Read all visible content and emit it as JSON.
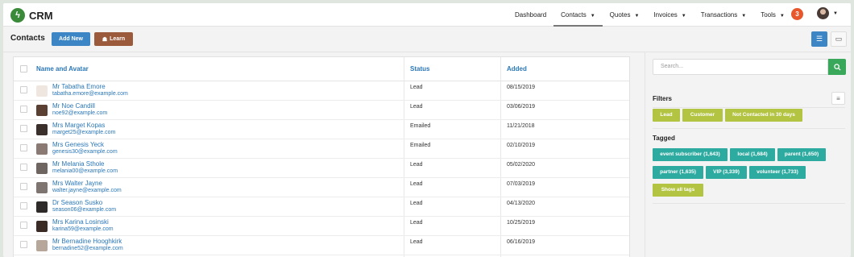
{
  "app": {
    "name": "CRM",
    "logo_glyph": "ϟ"
  },
  "nav": {
    "items": [
      {
        "label": "Dashboard",
        "dropdown": false,
        "active": false
      },
      {
        "label": "Contacts",
        "dropdown": true,
        "active": true
      },
      {
        "label": "Quotes",
        "dropdown": true,
        "active": false
      },
      {
        "label": "Invoices",
        "dropdown": true,
        "active": false
      },
      {
        "label": "Transactions",
        "dropdown": true,
        "active": false
      },
      {
        "label": "Tools",
        "dropdown": true,
        "active": false
      }
    ],
    "notification_count": "3"
  },
  "page": {
    "title": "Contacts",
    "add_new_label": "Add New",
    "learn_label": "Learn"
  },
  "table": {
    "columns": [
      "Name and Avatar",
      "Status",
      "Added"
    ],
    "rows": [
      {
        "name": "Mr Tabatha Emore",
        "email": "tabatha.emore@example.com",
        "status": "Lead",
        "added": "08/15/2019",
        "avatar_color": "#efe6e0"
      },
      {
        "name": "Mr Noe Candill",
        "email": "noe92@example.com",
        "status": "Lead",
        "added": "03/06/2019",
        "avatar_color": "#5a3f33"
      },
      {
        "name": "Mrs Marget Kopas",
        "email": "marget25@example.com",
        "status": "Emailed",
        "added": "11/21/2018",
        "avatar_color": "#3b2f2b"
      },
      {
        "name": "Mrs Genesis Yeck",
        "email": "genesis30@example.com",
        "status": "Emailed",
        "added": "02/10/2019",
        "avatar_color": "#8a7a73"
      },
      {
        "name": "Mr Melania Sthole",
        "email": "melania00@example.com",
        "status": "Lead",
        "added": "05/02/2020",
        "avatar_color": "#6f6560"
      },
      {
        "name": "Mrs Walter Jayne",
        "email": "walter.jayne@example.com",
        "status": "Lead",
        "added": "07/03/2019",
        "avatar_color": "#7e7470"
      },
      {
        "name": "Dr Season Susko",
        "email": "season06@example.com",
        "status": "Lead",
        "added": "04/13/2020",
        "avatar_color": "#2f2a2a"
      },
      {
        "name": "Mrs Karina Losinski",
        "email": "karina59@example.com",
        "status": "Lead",
        "added": "10/25/2019",
        "avatar_color": "#3a2b25"
      },
      {
        "name": "Mr Bernadine Hooghkirk",
        "email": "bernadine52@example.com",
        "status": "Lead",
        "added": "06/16/2019",
        "avatar_color": "#b7a79a"
      }
    ]
  },
  "sidebar": {
    "search_placeholder": "Search...",
    "filters_title": "Filters",
    "filters": [
      "Lead",
      "Customer",
      "Not Contacted in 30 days"
    ],
    "tagged_title": "Tagged",
    "tags": [
      "event subscriber (1,643)",
      "local (1,684)",
      "parent (1,650)",
      "partner (1,635)",
      "VIP (3,339)",
      "volunteer (1,733)"
    ],
    "show_all_label": "Show all tags"
  },
  "colors": {
    "primary": "#3d86c6",
    "learn": "#9b5a3c",
    "search_button": "#3aa85a",
    "filter_chip": "#b3c342",
    "tag_chip": "#2eaba0",
    "link": "#2a77b8",
    "badge": "#e8572b"
  }
}
